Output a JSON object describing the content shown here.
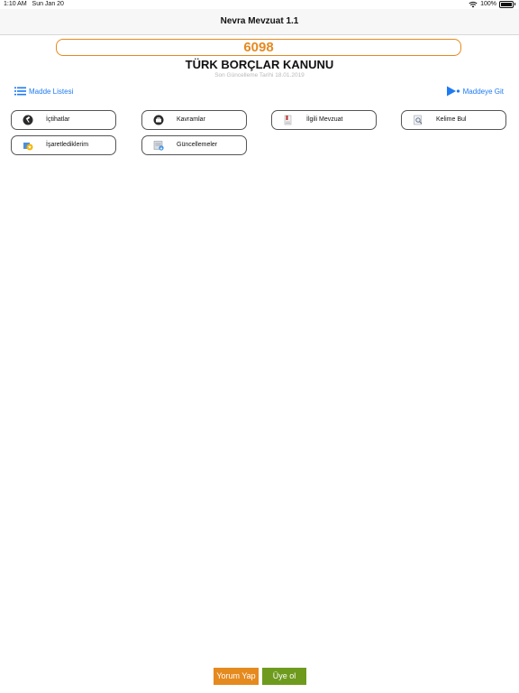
{
  "status_bar": {
    "time": "1:10 AM",
    "date": "Sun Jan 20",
    "battery": "100%"
  },
  "nav": {
    "title": "Nevra Mevzuat 1.1"
  },
  "law": {
    "number": "6098",
    "title": "TÜRK BORÇLAR KANUNU",
    "last_update": "Son Güncelleme Tarihi 18.01.2019"
  },
  "links": {
    "article_list": "Madde Listesi",
    "go_to_article": "Maddeye Git"
  },
  "menu": {
    "ictihatlar": "İçtihatlar",
    "kavramlar": "Kavramlar",
    "ilgili_mevzuat": "İlgili Mevzuat",
    "kelime_bul": "Kelime Bul",
    "isaretlediklerim": "İşaretlediklerim",
    "guncellemeler": "Güncellemeler"
  },
  "footer": {
    "comment_button": "Yorum Yap",
    "signup_button": "Üye ol"
  },
  "colors": {
    "accent_orange": "#e58a1f",
    "link_blue": "#1e7bf2",
    "signup_green": "#6e9b1e"
  }
}
